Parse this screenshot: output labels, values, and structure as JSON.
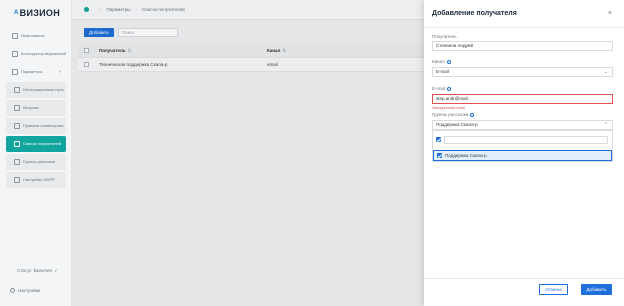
{
  "app": {
    "logo_mark": "A",
    "logo_text": "ВИЗИОН"
  },
  "sidebar": {
    "items": [
      {
        "label": "Инфопанель",
        "icon": "dashboard-icon"
      },
      {
        "label": "Конструктор выражений",
        "icon": "builder-icon"
      },
      {
        "label": "Параметры",
        "icon": "params-icon",
        "chevron": "˅"
      },
      {
        "label": "Интеграционные пути",
        "icon": "integration-icon"
      },
      {
        "label": "Метрики",
        "icon": "metrics-icon"
      },
      {
        "label": "Правила оповещения",
        "icon": "rules-icon"
      },
      {
        "label": "Список получателей",
        "icon": "recipients-icon"
      },
      {
        "label": "Группы рассылки",
        "icon": "groups-icon"
      },
      {
        "label": "Настройки SMTP",
        "icon": "smtp-icon"
      }
    ],
    "status_label": "Статус: Включен",
    "status_check": "✓",
    "settings_label": "Настройки"
  },
  "breadcrumb": {
    "items": [
      "Параметры",
      "Список получателей"
    ],
    "separator": "›"
  },
  "toolbar": {
    "add_label": "Добавить",
    "search_placeholder": "Поиск"
  },
  "table": {
    "columns": [
      "Получатель",
      "Канал"
    ],
    "sort_glyph": "⇅",
    "rows": [
      {
        "recipient": "Техническая поддержка Скала-р",
        "channel": "email"
      }
    ]
  },
  "panel": {
    "title": "Добавление получателя",
    "close": "×",
    "recipient_label": "Получатель",
    "recipient_value": "Степанов Андрей",
    "channel_label": "Канал",
    "channel_value": "E-mail",
    "email_label": "E-mail",
    "email_value": "step.andr@mail.",
    "email_error": "Некорректный email",
    "groups_label": "Группы рассылки",
    "groups_value": "Поддержка Скала-р",
    "groups_option": "Поддержка Скала-р",
    "cancel_label": "Отмена",
    "submit_label": "Добавить"
  },
  "colors": {
    "accent": "#1e6fd9",
    "active_nav": "#12a5a0",
    "error": "#e05252"
  }
}
